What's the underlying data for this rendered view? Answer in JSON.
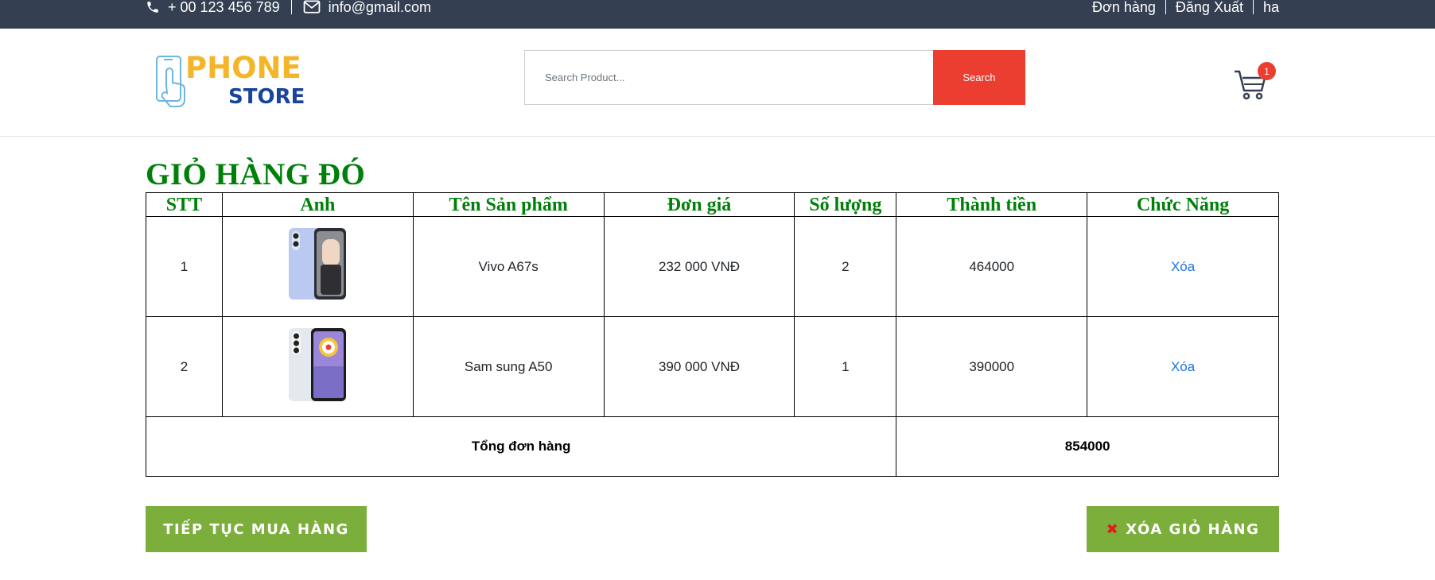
{
  "topbar": {
    "phone": "+ 00 123 456 789",
    "email": "info@gmail.com",
    "links": [
      "Đơn hàng",
      "Đăng Xuất",
      "ha"
    ]
  },
  "header": {
    "logo_line1": "PHONE",
    "logo_line2": "STORE",
    "search_placeholder": "Search Product...",
    "search_button": "Search",
    "cart_count": "1"
  },
  "page_title": "GIỎ HÀNG ĐÓ",
  "table": {
    "headers": [
      "STT",
      "Anh",
      "Tên Sản phẩm",
      "Đơn giá",
      "Số lượng",
      "Thành tiền",
      "Chức Năng"
    ],
    "rows": [
      {
        "stt": "1",
        "name": "Vivo A67s",
        "price": "232 000 VNĐ",
        "qty": "2",
        "total": "464000",
        "action": "Xóa"
      },
      {
        "stt": "2",
        "name": "Sam sung A50",
        "price": "390 000 VNĐ",
        "qty": "1",
        "total": "390000",
        "action": "Xóa"
      }
    ],
    "total_label": "Tổng đơn hàng",
    "total_value": "854000"
  },
  "buttons": {
    "continue": "TIẾP TỤC MUA HÀNG",
    "clear": "XÓA GIỎ HÀNG"
  },
  "colors": {
    "topbar": "#343f52",
    "accent_red": "#ec3d31",
    "title_green": "#00800a",
    "button_green": "#7cae3b",
    "link_blue": "#1a73e8"
  }
}
